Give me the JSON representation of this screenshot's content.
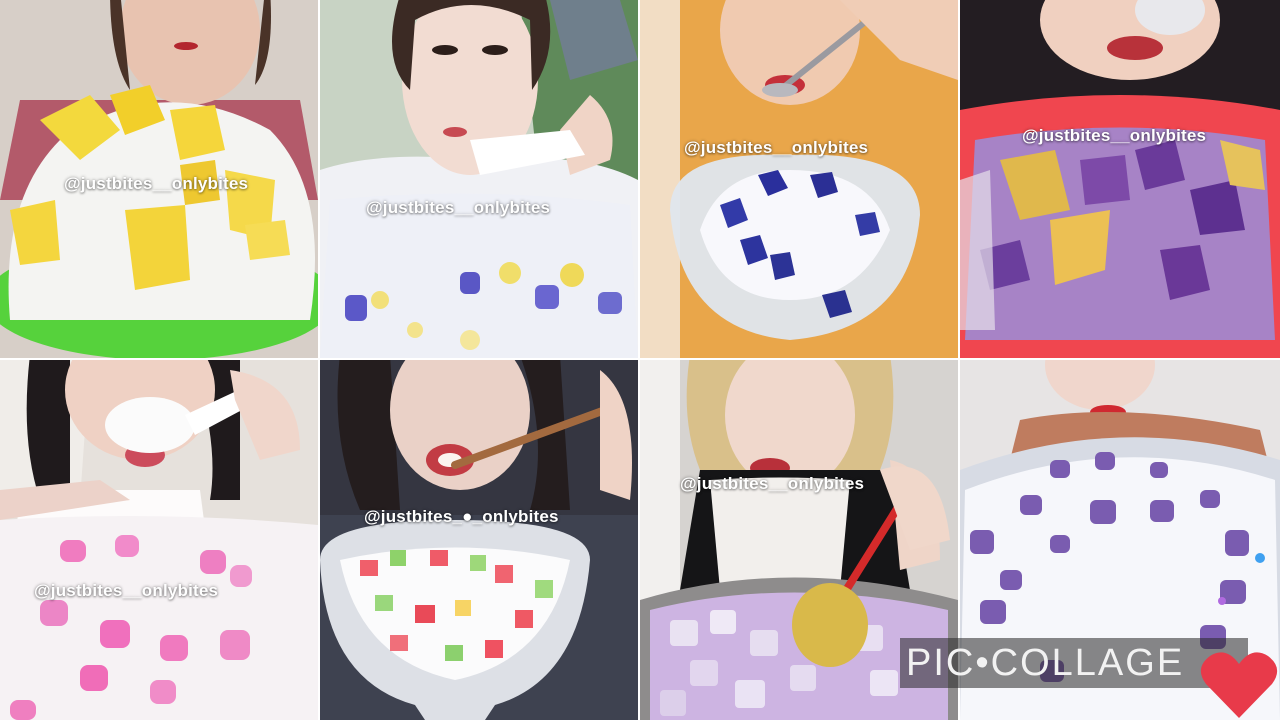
{
  "watermarks": [
    "@justbites__onlybites",
    "@justbites__onlybites",
    "@justbites__onlybites",
    "@justbites__onlybites",
    "@justbites__onlybites",
    "@justbites_●_onlybites",
    "@justbites__onlybites"
  ],
  "brand": {
    "text": "PIC•COLLAGE",
    "heart_color": "#e83a4a"
  },
  "tiles": [
    {
      "subject": "shaved ice with yellow jelly cubes on green plate"
    },
    {
      "subject": "shaved ice with blue and yellow jelly in clear tray"
    },
    {
      "subject": "shaved ice with dark blue jelly in glass bowl"
    },
    {
      "subject": "purple shaved ice with yellow jelly in red basin"
    },
    {
      "subject": "shaved ice with pink jelly in clear box"
    },
    {
      "subject": "shaved ice with red and green jelly in glass bowl"
    },
    {
      "subject": "purple ice cubes in metal bowl with gold spoon"
    },
    {
      "subject": "shaved ice with purple jelly in large bowl"
    }
  ]
}
